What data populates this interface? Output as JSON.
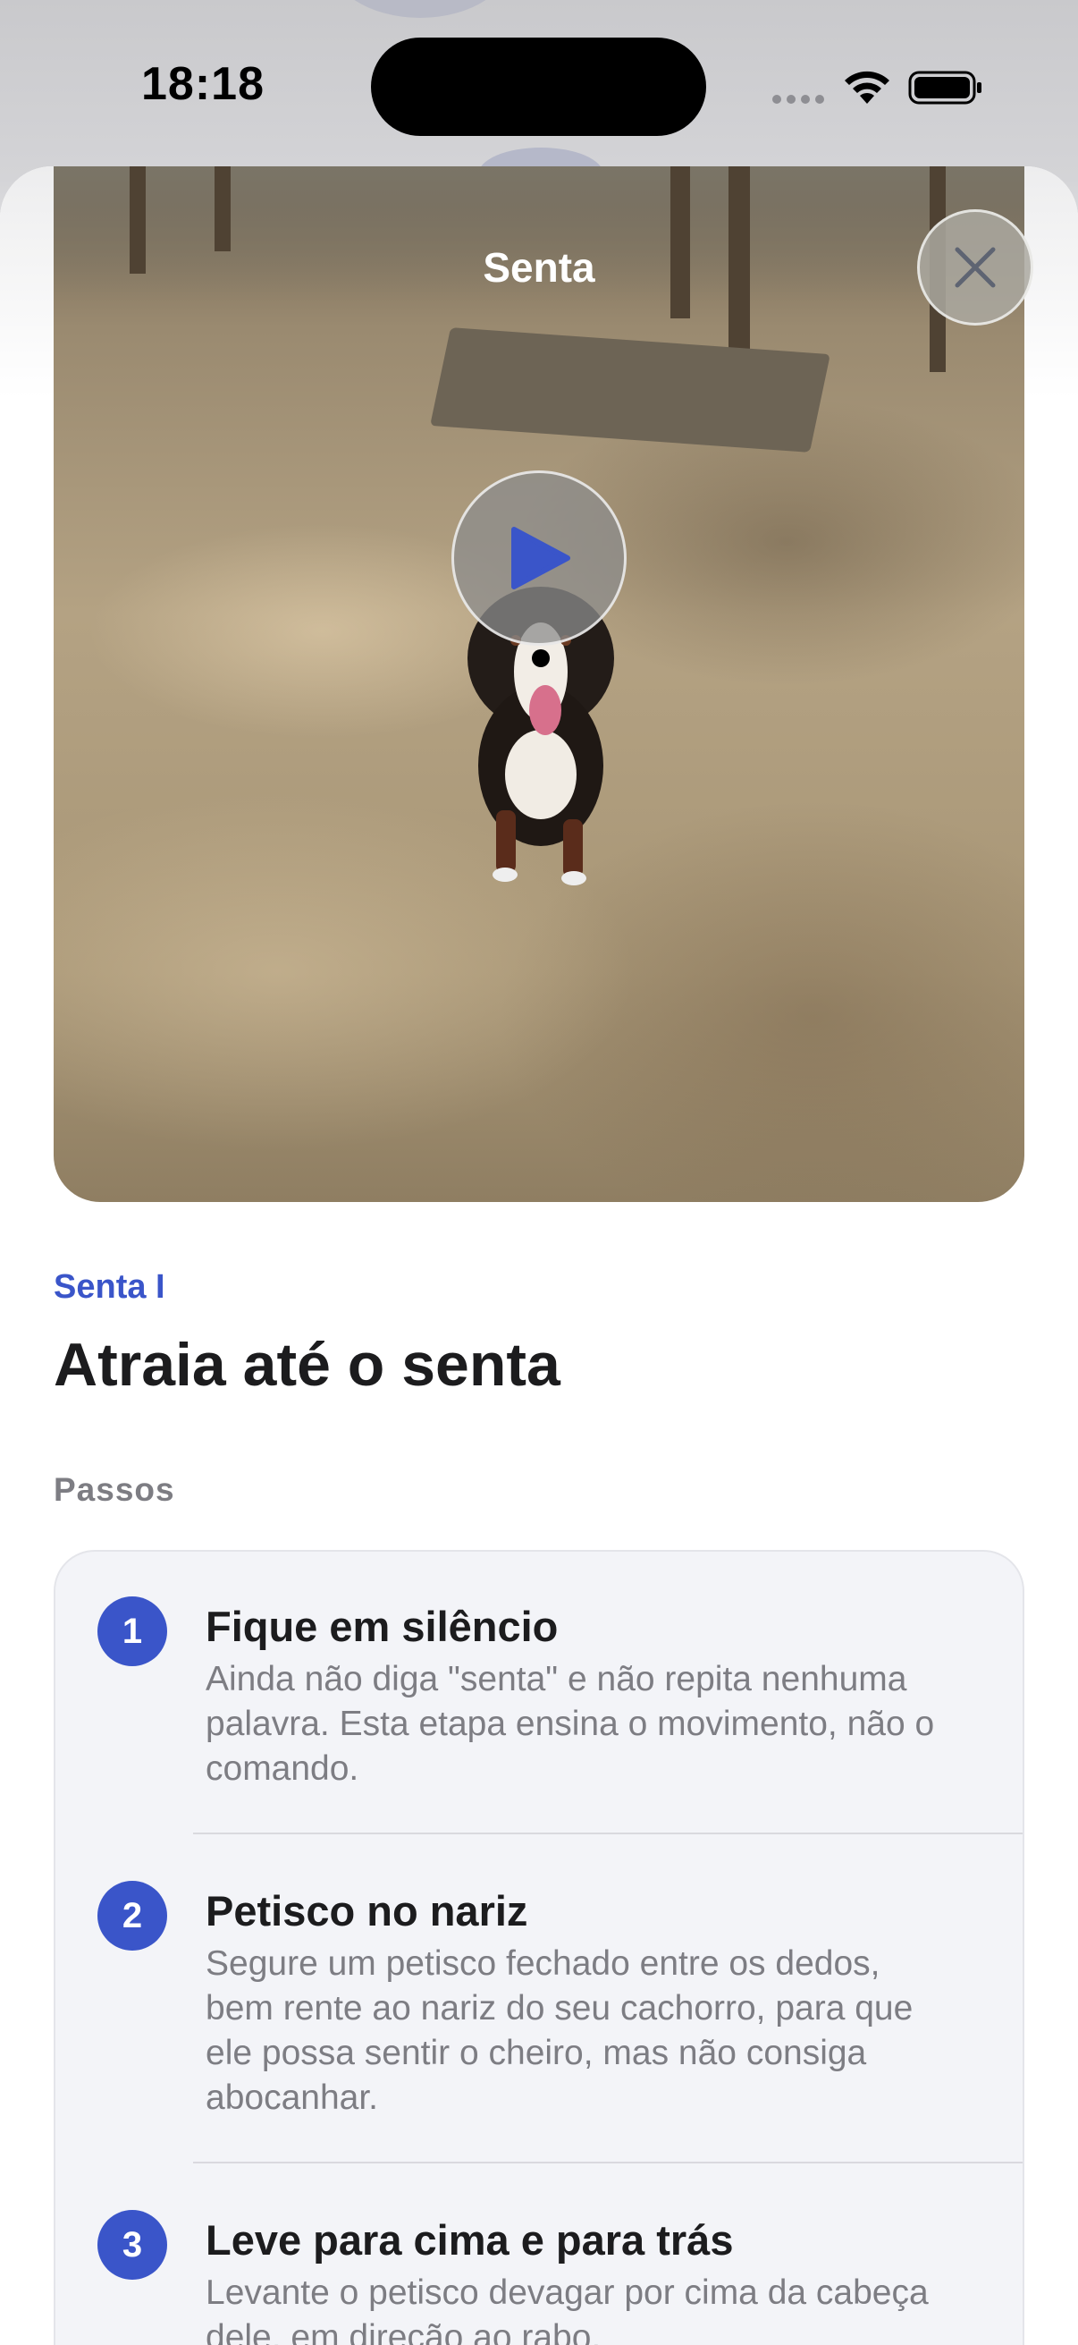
{
  "status_bar": {
    "time": "18:18"
  },
  "video": {
    "title": "Senta",
    "close_icon": "close-icon",
    "play_icon": "play-icon"
  },
  "lesson": {
    "category": "Senta I",
    "title": "Atraia até o senta",
    "steps_label": "Passos",
    "steps": [
      {
        "number": "1",
        "title": "Fique em silêncio",
        "description": "Ainda não diga \"senta\" e não repita nenhuma palavra. Esta etapa ensina o movimento, não o comando."
      },
      {
        "number": "2",
        "title": "Petisco no nariz",
        "description": "Segure um petisco fechado entre os dedos, bem rente ao nariz do seu cachorro, para que ele possa sentir o cheiro, mas não consiga abocanhar."
      },
      {
        "number": "3",
        "title": "Leve para cima e para trás",
        "description": "Levante o petisco devagar por cima da cabeça dele, em direção ao rabo."
      }
    ]
  },
  "colors": {
    "accent": "#3a55c9",
    "secondary_text": "#7d7d83",
    "card_background": "#f3f4f8"
  }
}
